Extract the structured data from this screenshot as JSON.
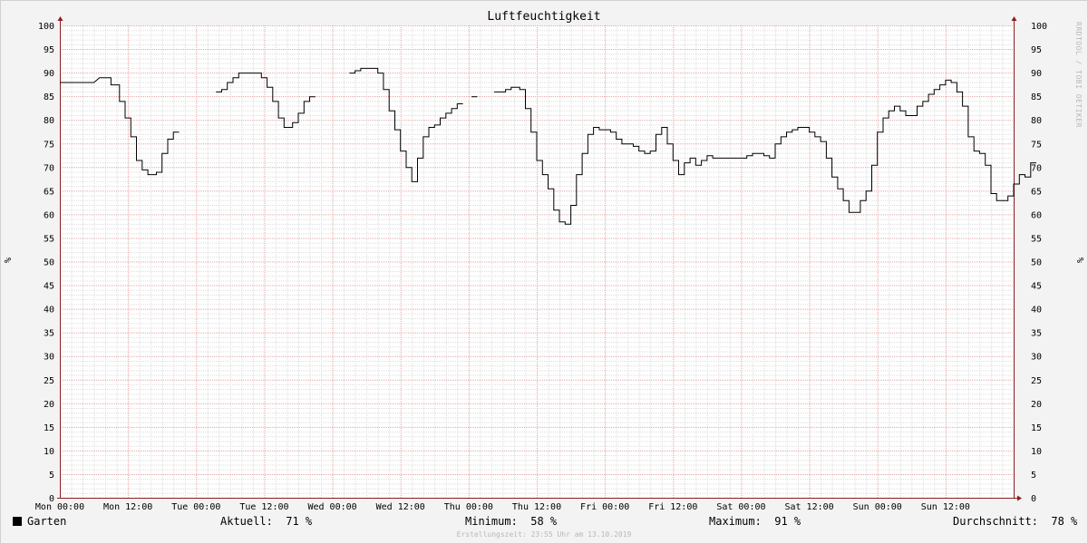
{
  "chart_data": {
    "type": "line",
    "title": "Luftfeuchtigkeit",
    "ylabel": "%",
    "ylim": [
      0,
      100
    ],
    "y_ticks": [
      0,
      5,
      10,
      15,
      20,
      25,
      30,
      35,
      40,
      45,
      50,
      55,
      60,
      65,
      70,
      75,
      80,
      85,
      90,
      95,
      100
    ],
    "x_axis_unit": "hours since Mon 00:00",
    "xlim": [
      0,
      168
    ],
    "x_tick_labels": [
      "Mon 00:00",
      "Mon 12:00",
      "Tue 00:00",
      "Tue 12:00",
      "Wed 00:00",
      "Wed 12:00",
      "Thu 00:00",
      "Thu 12:00",
      "Fri 00:00",
      "Fri 12:00",
      "Sat 00:00",
      "Sat 12:00",
      "Sun 00:00",
      "Sun 12:00"
    ],
    "x_tick_values": [
      0,
      12,
      24,
      36,
      48,
      60,
      72,
      84,
      96,
      108,
      120,
      132,
      144,
      156
    ],
    "grid": true,
    "series": [
      {
        "name": "Garten",
        "color": "#000000",
        "segments": [
          [
            [
              0,
              88
            ],
            [
              6,
              88
            ],
            [
              7,
              89
            ],
            [
              9,
              89
            ],
            [
              9,
              87.5
            ],
            [
              10.5,
              87.5
            ],
            [
              10.5,
              84
            ],
            [
              11.5,
              84
            ],
            [
              11.5,
              80.5
            ],
            [
              12.5,
              80.5
            ],
            [
              12.5,
              76.5
            ],
            [
              13.5,
              76.5
            ],
            [
              13.5,
              71.5
            ],
            [
              14.5,
              71.5
            ],
            [
              14.5,
              69.5
            ],
            [
              15.5,
              69.5
            ],
            [
              15.5,
              68.5
            ],
            [
              17,
              68.5
            ],
            [
              17,
              69
            ],
            [
              18,
              69
            ],
            [
              18,
              73
            ],
            [
              19,
              73
            ],
            [
              19,
              76
            ],
            [
              20,
              76
            ],
            [
              20,
              77.5
            ],
            [
              21,
              77.5
            ]
          ],
          [
            [
              27.5,
              86
            ],
            [
              28.5,
              86
            ],
            [
              28.5,
              86.5
            ],
            [
              29.5,
              86.5
            ],
            [
              29.5,
              88
            ],
            [
              30.5,
              88
            ],
            [
              30.5,
              89
            ],
            [
              31.5,
              89
            ],
            [
              31.5,
              90
            ],
            [
              35.5,
              90
            ],
            [
              35.5,
              89
            ],
            [
              36.5,
              89
            ],
            [
              36.5,
              87
            ],
            [
              37.5,
              87
            ],
            [
              37.5,
              84
            ],
            [
              38.5,
              84
            ],
            [
              38.5,
              80.5
            ],
            [
              39.5,
              80.5
            ],
            [
              39.5,
              78.5
            ],
            [
              41,
              78.5
            ],
            [
              41,
              79.5
            ],
            [
              42,
              79.5
            ],
            [
              42,
              81.5
            ],
            [
              43,
              81.5
            ],
            [
              43,
              84
            ],
            [
              44,
              84
            ],
            [
              44,
              85
            ],
            [
              45,
              85
            ]
          ],
          [
            [
              51,
              90
            ],
            [
              52,
              90
            ],
            [
              52,
              90.5
            ],
            [
              53,
              90.5
            ],
            [
              53,
              91
            ],
            [
              56,
              91
            ],
            [
              56,
              90
            ],
            [
              57,
              90
            ],
            [
              57,
              86.5
            ],
            [
              58,
              86.5
            ],
            [
              58,
              82
            ],
            [
              59,
              82
            ],
            [
              59,
              78
            ],
            [
              60,
              78
            ],
            [
              60,
              73.5
            ],
            [
              61,
              73.5
            ],
            [
              61,
              70
            ],
            [
              62,
              70
            ],
            [
              62,
              67
            ],
            [
              63,
              67
            ],
            [
              63,
              72
            ],
            [
              64,
              72
            ],
            [
              64,
              76.5
            ],
            [
              65,
              76.5
            ],
            [
              65,
              78.5
            ],
            [
              66,
              78.5
            ],
            [
              66,
              79
            ],
            [
              67,
              79
            ],
            [
              67,
              80.5
            ],
            [
              68,
              80.5
            ],
            [
              68,
              81.5
            ],
            [
              69,
              81.5
            ],
            [
              69,
              82.5
            ],
            [
              70,
              82.5
            ],
            [
              70,
              83.5
            ],
            [
              71,
              83.5
            ]
          ],
          [
            [
              72.5,
              85
            ],
            [
              73.5,
              85
            ]
          ],
          [
            [
              76.5,
              86
            ],
            [
              78.5,
              86
            ],
            [
              78.5,
              86.5
            ],
            [
              79.5,
              86.5
            ],
            [
              79.5,
              87
            ],
            [
              81,
              87
            ],
            [
              81,
              86.5
            ],
            [
              82,
              86.5
            ],
            [
              82,
              82.5
            ],
            [
              83,
              82.5
            ],
            [
              83,
              77.5
            ],
            [
              84,
              77.5
            ],
            [
              84,
              71.5
            ],
            [
              85,
              71.5
            ],
            [
              85,
              68.5
            ],
            [
              86,
              68.5
            ],
            [
              86,
              65.5
            ],
            [
              87,
              65.5
            ],
            [
              87,
              61
            ],
            [
              88,
              61
            ],
            [
              88,
              58.5
            ],
            [
              89,
              58.5
            ],
            [
              89,
              58
            ],
            [
              90,
              58
            ],
            [
              90,
              62
            ],
            [
              91,
              62
            ],
            [
              91,
              68.5
            ],
            [
              92,
              68.5
            ],
            [
              92,
              73
            ],
            [
              93,
              73
            ],
            [
              93,
              77
            ],
            [
              94,
              77
            ],
            [
              94,
              78.5
            ],
            [
              95,
              78.5
            ],
            [
              95,
              78
            ],
            [
              97,
              78
            ],
            [
              97,
              77.5
            ],
            [
              98,
              77.5
            ],
            [
              98,
              76
            ],
            [
              99,
              76
            ],
            [
              99,
              75
            ],
            [
              101,
              75
            ],
            [
              101,
              74.5
            ],
            [
              102,
              74.5
            ],
            [
              102,
              73.5
            ],
            [
              103,
              73.5
            ],
            [
              103,
              73
            ],
            [
              104,
              73
            ],
            [
              104,
              73.5
            ],
            [
              105,
              73.5
            ],
            [
              105,
              77
            ],
            [
              106,
              77
            ],
            [
              106,
              78.5
            ],
            [
              107,
              78.5
            ],
            [
              107,
              75
            ],
            [
              108,
              75
            ],
            [
              108,
              71.5
            ],
            [
              109,
              71.5
            ],
            [
              109,
              68.5
            ],
            [
              110,
              68.5
            ],
            [
              110,
              71
            ],
            [
              111,
              71
            ],
            [
              111,
              72
            ],
            [
              112,
              72
            ],
            [
              112,
              70.5
            ],
            [
              113,
              70.5
            ],
            [
              113,
              71.5
            ],
            [
              114,
              71.5
            ],
            [
              114,
              72.5
            ],
            [
              115,
              72.5
            ],
            [
              115,
              72
            ],
            [
              121,
              72
            ],
            [
              121,
              72.5
            ],
            [
              122,
              72.5
            ],
            [
              122,
              73
            ],
            [
              124,
              73
            ],
            [
              124,
              72.5
            ],
            [
              125,
              72.5
            ],
            [
              125,
              72
            ],
            [
              126,
              72
            ],
            [
              126,
              75
            ],
            [
              127,
              75
            ],
            [
              127,
              76.5
            ],
            [
              128,
              76.5
            ],
            [
              128,
              77.5
            ],
            [
              129,
              77.5
            ],
            [
              129,
              78
            ],
            [
              130,
              78
            ],
            [
              130,
              78.5
            ],
            [
              132,
              78.5
            ],
            [
              132,
              77.5
            ],
            [
              133,
              77.5
            ],
            [
              133,
              76.5
            ],
            [
              134,
              76.5
            ],
            [
              134,
              75.5
            ],
            [
              135,
              75.5
            ],
            [
              135,
              72
            ],
            [
              136,
              72
            ],
            [
              136,
              68
            ],
            [
              137,
              68
            ],
            [
              137,
              65.5
            ],
            [
              138,
              65.5
            ],
            [
              138,
              63
            ],
            [
              139,
              63
            ],
            [
              139,
              60.5
            ],
            [
              141,
              60.5
            ],
            [
              141,
              63
            ],
            [
              142,
              63
            ],
            [
              142,
              65
            ],
            [
              143,
              65
            ],
            [
              143,
              70.5
            ],
            [
              144,
              70.5
            ],
            [
              144,
              77.5
            ],
            [
              145,
              77.5
            ],
            [
              145,
              80.5
            ],
            [
              146,
              80.5
            ],
            [
              146,
              82
            ],
            [
              147,
              82
            ],
            [
              147,
              83
            ],
            [
              148,
              83
            ],
            [
              148,
              82
            ],
            [
              149,
              82
            ],
            [
              149,
              81
            ],
            [
              151,
              81
            ],
            [
              151,
              83
            ],
            [
              152,
              83
            ],
            [
              152,
              84
            ],
            [
              153,
              84
            ],
            [
              153,
              85.5
            ],
            [
              154,
              85.5
            ],
            [
              154,
              86.5
            ],
            [
              155,
              86.5
            ],
            [
              155,
              87.5
            ],
            [
              156,
              87.5
            ],
            [
              156,
              88.5
            ],
            [
              157,
              88.5
            ],
            [
              157,
              88
            ],
            [
              158,
              88
            ],
            [
              158,
              86
            ],
            [
              159,
              86
            ],
            [
              159,
              83
            ],
            [
              160,
              83
            ],
            [
              160,
              76.5
            ],
            [
              161,
              76.5
            ],
            [
              161,
              73.5
            ],
            [
              162,
              73.5
            ],
            [
              162,
              73
            ],
            [
              163,
              73
            ],
            [
              163,
              70.5
            ],
            [
              164,
              70.5
            ],
            [
              164,
              64.5
            ],
            [
              165,
              64.5
            ],
            [
              165,
              63
            ],
            [
              167,
              63
            ],
            [
              167,
              64
            ],
            [
              168,
              64
            ],
            [
              168,
              66.5
            ],
            [
              169,
              66.5
            ],
            [
              169,
              68.5
            ],
            [
              170,
              68.5
            ],
            [
              170,
              68
            ],
            [
              171,
              68
            ],
            [
              171,
              71
            ],
            [
              172,
              71
            ]
          ]
        ]
      }
    ]
  },
  "legend": {
    "series_name": "Garten",
    "current_label": "Aktuell:",
    "current_value": "71 %",
    "min_label": "Minimum:",
    "min_value": "58 %",
    "max_label": "Maximum:",
    "max_value": "91 %",
    "avg_label": "Durchschnitt:",
    "avg_value": "78 %"
  },
  "watermark": "RRDTOOL / TOBI OETIKER",
  "footer": "Erstellungszeit: 23:55 Uhr am 13.10.2019"
}
